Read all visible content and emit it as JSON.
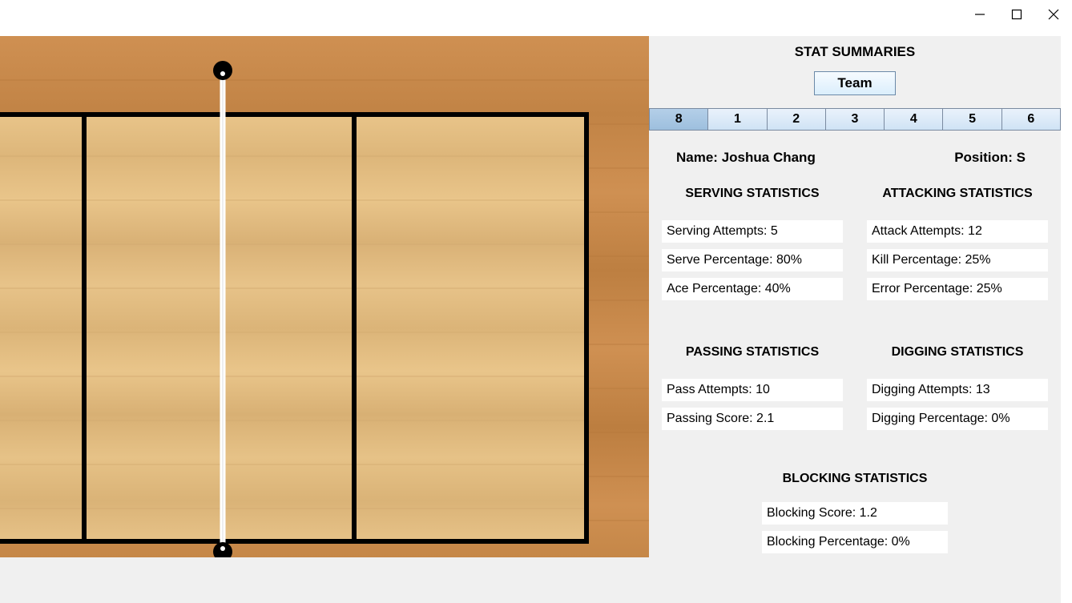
{
  "titlebar": {
    "minimize": "minimize",
    "maximize": "maximize",
    "close": "close"
  },
  "stats": {
    "title": "STAT SUMMARIES",
    "team_button": "Team",
    "player_numbers": [
      "8",
      "1",
      "2",
      "3",
      "4",
      "5",
      "6"
    ],
    "selected_player_index": 0,
    "name_label": "Name:",
    "name_value": "Joshua Chang",
    "position_label": "Position:",
    "position_value": "S",
    "serving": {
      "header": "SERVING STATISTICS",
      "attempts": "Serving Attempts: 5",
      "serve_pct": "Serve Percentage: 80%",
      "ace_pct": "Ace Percentage: 40%"
    },
    "attacking": {
      "header": "ATTACKING STATISTICS",
      "attempts": "Attack Attempts: 12",
      "kill_pct": "Kill Percentage: 25%",
      "error_pct": "Error Percentage: 25%"
    },
    "passing": {
      "header": "PASSING STATISTICS",
      "attempts": "Pass Attempts: 10",
      "score": "Passing Score: 2.1"
    },
    "digging": {
      "header": "DIGGING STATISTICS",
      "attempts": "Digging Attempts: 13",
      "pct": "Digging Percentage: 0%"
    },
    "blocking": {
      "header": "BLOCKING STATISTICS",
      "score": "Blocking Score: 1.2",
      "pct": "Blocking Percentage: 0%"
    }
  }
}
